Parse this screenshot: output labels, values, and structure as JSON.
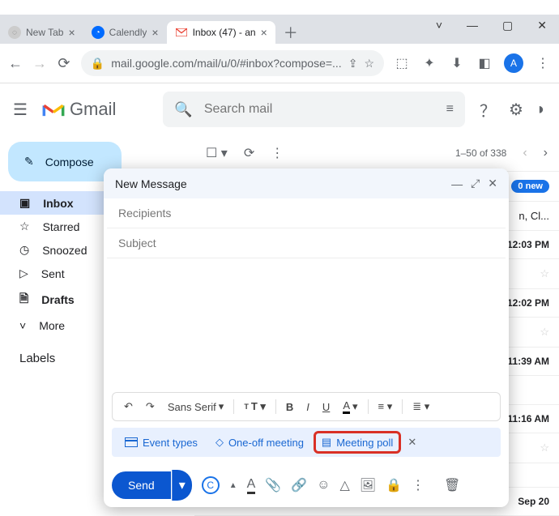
{
  "window": {
    "minimize": "—",
    "maximize": "▢",
    "close": "✕",
    "dropdown": "˅"
  },
  "tabs": [
    {
      "title": "New Tab"
    },
    {
      "title": "Calendly"
    },
    {
      "title": "Inbox (47) - an"
    }
  ],
  "newTab": "＋",
  "address": {
    "url": "mail.google.com/mail/u/0/#inbox?compose=...",
    "avatar": "A"
  },
  "gmail": {
    "brand": "Gmail",
    "searchPlaceholder": "Search mail"
  },
  "compose_label": "Compose",
  "sidebar": {
    "items": [
      {
        "label": "Inbox"
      },
      {
        "label": "Starred"
      },
      {
        "label": "Snoozed"
      },
      {
        "label": "Sent"
      },
      {
        "label": "Drafts"
      },
      {
        "label": "More"
      }
    ],
    "labels_header": "Labels"
  },
  "toolbar": {
    "pagination": "1–50 of 338"
  },
  "mail": {
    "new_badge": "0 new",
    "snippet0": "n, Cl...",
    "rows": [
      {
        "time": "12:03 PM"
      },
      {
        "time": "12:02 PM"
      },
      {
        "time": "11:39 AM"
      },
      {
        "time": "11:16 AM"
      },
      {
        "time": "Sep 20"
      }
    ]
  },
  "compose": {
    "title": "New Message",
    "recipients": "Recipients",
    "subject": "Subject",
    "font": "Sans Serif",
    "format": {
      "bold": "B",
      "italic": "I",
      "underline": "U",
      "textcolor": "A"
    },
    "chips": {
      "event_types": "Event types",
      "one_off": "One-off meeting",
      "meeting_poll": "Meeting poll"
    },
    "send": "Send"
  }
}
